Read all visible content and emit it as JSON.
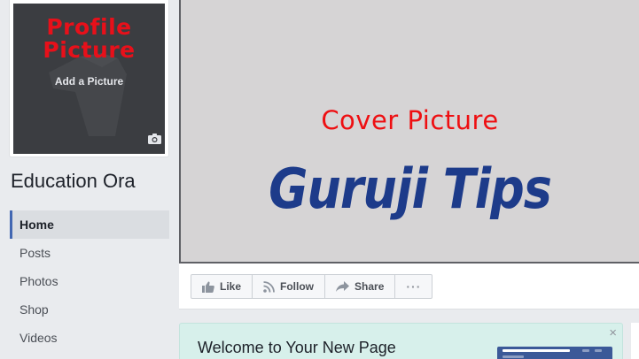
{
  "profile": {
    "overlay_text": "Profile Picture",
    "add_label": "Add a Picture"
  },
  "page": {
    "name": "Education Ora"
  },
  "nav": {
    "items": [
      "Home",
      "Posts",
      "Photos",
      "Shop",
      "Videos"
    ],
    "active": "Home"
  },
  "cover": {
    "label": "Cover Picture",
    "brand": "Guruji Tips"
  },
  "actions": {
    "like": "Like",
    "follow": "Follow",
    "share": "Share",
    "more": "···"
  },
  "welcome": {
    "title": "Welcome to Your New Page",
    "close": "×"
  },
  "icons": {
    "camera": "camera-icon",
    "like": "thumbs-up-icon",
    "follow": "rss-icon",
    "share": "share-arrow-icon"
  },
  "colors": {
    "accent": "#4267b2",
    "handwritten_red": "#e8101a",
    "brand_blue": "#1d3b8a",
    "welcome_bg": "#d7f0eb"
  }
}
